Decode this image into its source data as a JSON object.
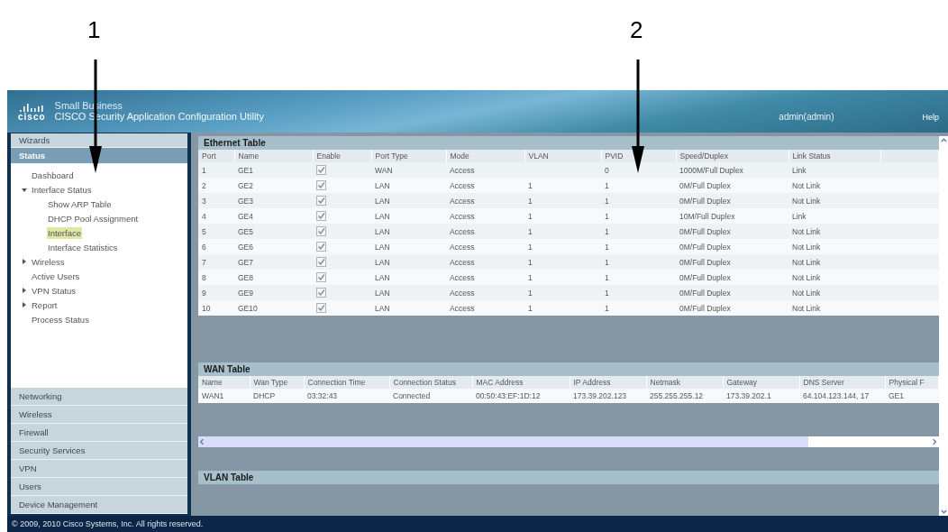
{
  "callouts": [
    {
      "label": "1"
    },
    {
      "label": "2"
    }
  ],
  "header": {
    "logo_text": "cisco",
    "product_line": "Small Business",
    "title": "CISCO Security Application Configuration Utility",
    "user": "admin(admin)",
    "help": "Help"
  },
  "sidebar": {
    "top_sections": [
      {
        "label": "Wizards",
        "selected": false
      },
      {
        "label": "Status",
        "selected": true
      }
    ],
    "tree": [
      {
        "label": "Dashboard",
        "selected": false
      },
      {
        "label": "Interface Status",
        "selected": false,
        "expanded": true,
        "children": [
          {
            "label": "Show ARP Table",
            "selected": false
          },
          {
            "label": "DHCP Pool Assignment",
            "selected": false
          },
          {
            "label": "Interface",
            "selected": true
          },
          {
            "label": "Interface Statistics",
            "selected": false
          }
        ]
      },
      {
        "label": "Wireless",
        "selected": false,
        "expanded": false
      },
      {
        "label": "Active Users",
        "selected": false
      },
      {
        "label": "VPN Status",
        "selected": false,
        "expanded": false
      },
      {
        "label": "Report",
        "selected": false,
        "expanded": false
      },
      {
        "label": "Process Status",
        "selected": false
      }
    ],
    "bottom_sections": [
      {
        "label": "Networking",
        "selected": false
      },
      {
        "label": "Wireless",
        "selected": false
      },
      {
        "label": "Firewall",
        "selected": false
      },
      {
        "label": "Security Services",
        "selected": false
      },
      {
        "label": "VPN",
        "selected": false
      },
      {
        "label": "Users",
        "selected": false
      },
      {
        "label": "Device Management",
        "selected": false
      }
    ]
  },
  "ethernet_table": {
    "title": "Ethernet Table",
    "columns": [
      "Port",
      "Name",
      "Enable",
      "Port Type",
      "Mode",
      "VLAN",
      "PVID",
      "Speed/Duplex",
      "Link Status"
    ],
    "rows": [
      {
        "port": "1",
        "name": "GE1",
        "enabled": true,
        "port_type": "WAN",
        "mode": "Access",
        "vlan": "",
        "pvid": "0",
        "speed": "1000M/Full Duplex",
        "link": "Link"
      },
      {
        "port": "2",
        "name": "GE2",
        "enabled": true,
        "port_type": "LAN",
        "mode": "Access",
        "vlan": "1",
        "pvid": "1",
        "speed": "0M/Full Duplex",
        "link": "Not Link"
      },
      {
        "port": "3",
        "name": "GE3",
        "enabled": true,
        "port_type": "LAN",
        "mode": "Access",
        "vlan": "1",
        "pvid": "1",
        "speed": "0M/Full Duplex",
        "link": "Not Link"
      },
      {
        "port": "4",
        "name": "GE4",
        "enabled": true,
        "port_type": "LAN",
        "mode": "Access",
        "vlan": "1",
        "pvid": "1",
        "speed": "10M/Full Duplex",
        "link": "Link"
      },
      {
        "port": "5",
        "name": "GE5",
        "enabled": true,
        "port_type": "LAN",
        "mode": "Access",
        "vlan": "1",
        "pvid": "1",
        "speed": "0M/Full Duplex",
        "link": "Not Link"
      },
      {
        "port": "6",
        "name": "GE6",
        "enabled": true,
        "port_type": "LAN",
        "mode": "Access",
        "vlan": "1",
        "pvid": "1",
        "speed": "0M/Full Duplex",
        "link": "Not Link"
      },
      {
        "port": "7",
        "name": "GE7",
        "enabled": true,
        "port_type": "LAN",
        "mode": "Access",
        "vlan": "1",
        "pvid": "1",
        "speed": "0M/Full Duplex",
        "link": "Not Link"
      },
      {
        "port": "8",
        "name": "GE8",
        "enabled": true,
        "port_type": "LAN",
        "mode": "Access",
        "vlan": "1",
        "pvid": "1",
        "speed": "0M/Full Duplex",
        "link": "Not Link"
      },
      {
        "port": "9",
        "name": "GE9",
        "enabled": true,
        "port_type": "LAN",
        "mode": "Access",
        "vlan": "1",
        "pvid": "1",
        "speed": "0M/Full Duplex",
        "link": "Not Link"
      },
      {
        "port": "10",
        "name": "GE10",
        "enabled": true,
        "port_type": "LAN",
        "mode": "Access",
        "vlan": "1",
        "pvid": "1",
        "speed": "0M/Full Duplex",
        "link": "Not Link"
      }
    ]
  },
  "wan_table": {
    "title": "WAN Table",
    "columns": [
      "Name",
      "Wan Type",
      "Connection Time",
      "Connection Status",
      "MAC Address",
      "IP Address",
      "Netmask",
      "Gateway",
      "DNS Server",
      "Physical F"
    ],
    "rows": [
      [
        "WAN1",
        "DHCP",
        "03:32:43",
        "Connected",
        "00:50:43:EF:1D:12",
        "173.39.202.123",
        "255.255.255.12",
        "173.39.202.1",
        "64.104.123.144, 17",
        "GE1"
      ]
    ]
  },
  "vlan_table": {
    "title": "VLAN Table"
  },
  "footer": {
    "copyright": "© 2009, 2010 Cisco Systems, Inc. All rights reserved."
  }
}
